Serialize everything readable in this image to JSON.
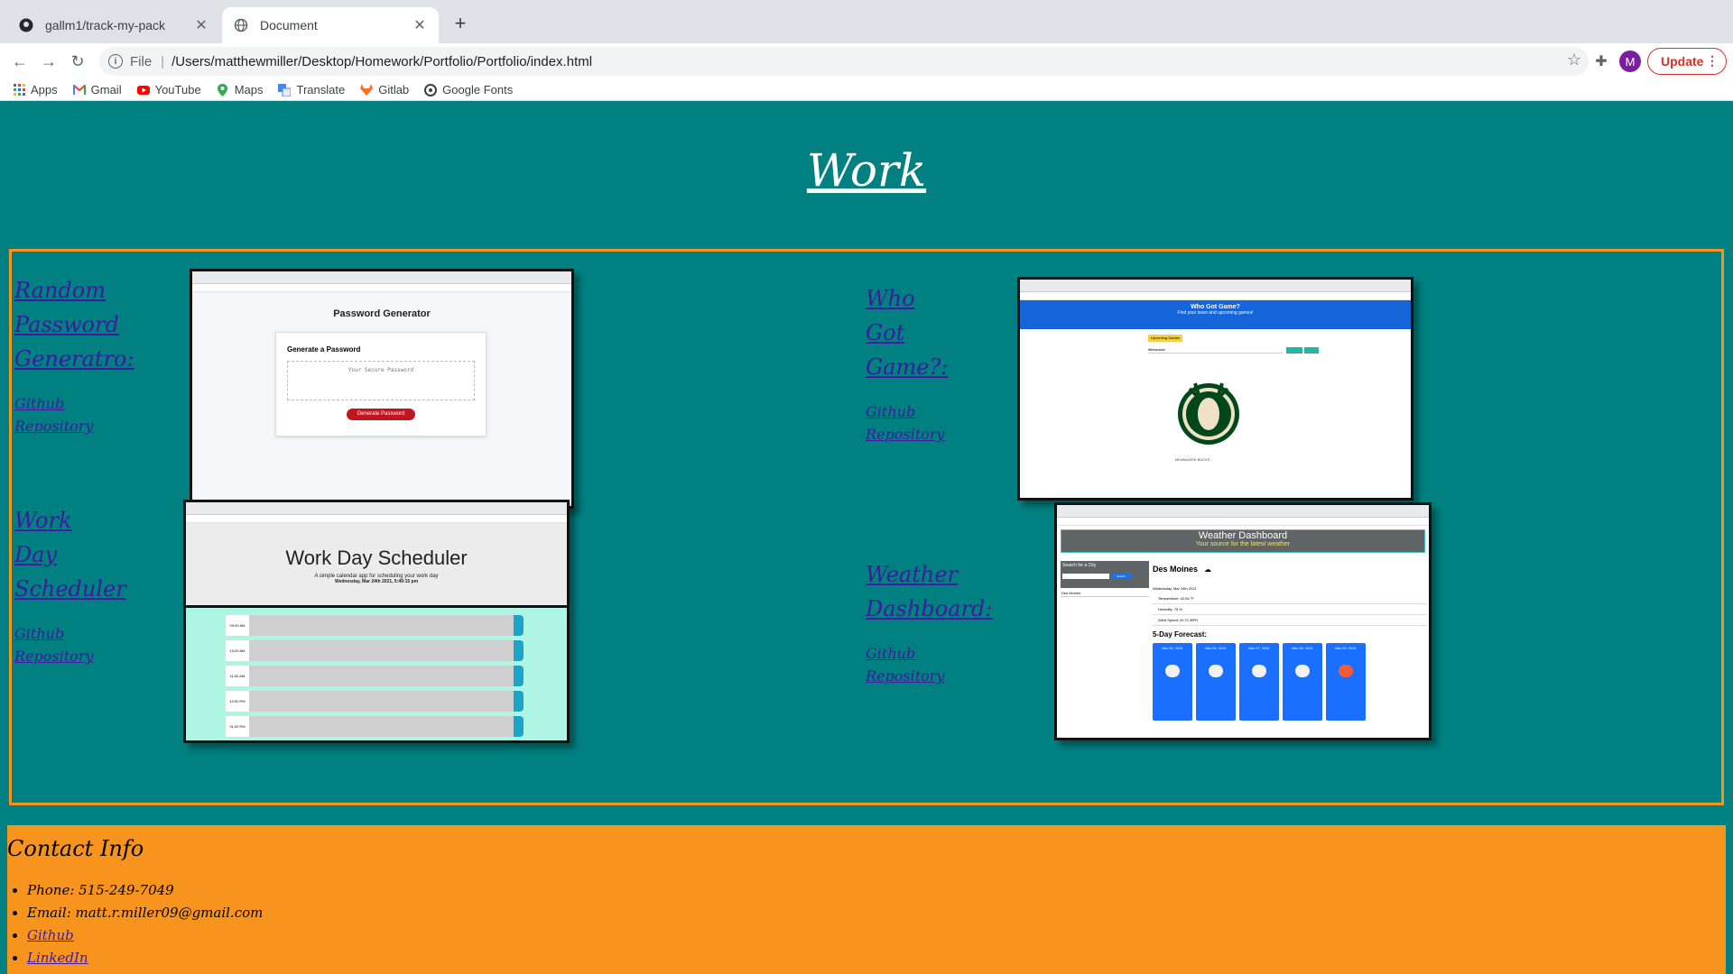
{
  "browser": {
    "tabs": [
      {
        "label": "gallm1/track-my-pack",
        "icon": "github-icon"
      },
      {
        "label": "Document",
        "icon": "globe-icon"
      }
    ],
    "new_tab": "+",
    "address": {
      "scheme": "File",
      "url": "/Users/matthewmiller/Desktop/Homework/Portfolio/Portfolio/index.html"
    },
    "avatar_initial": "M",
    "update_label": "Update",
    "bookmarks": [
      {
        "label": "Apps",
        "icon": "apps-grid-icon"
      },
      {
        "label": "Gmail",
        "icon": "gmail-icon"
      },
      {
        "label": "YouTube",
        "icon": "youtube-icon"
      },
      {
        "label": "Maps",
        "icon": "maps-icon"
      },
      {
        "label": "Translate",
        "icon": "translate-icon"
      },
      {
        "label": "Gitlab",
        "icon": "gitlab-icon"
      },
      {
        "label": "Google Fonts",
        "icon": "google-fonts-icon"
      }
    ]
  },
  "page": {
    "heading": "Work",
    "projects": [
      {
        "title_lines": [
          "Random",
          "Password",
          "Generatro:"
        ],
        "repo_lines": [
          "Github",
          "Repository"
        ],
        "screenshot": {
          "heading": "Password Generator",
          "card_title": "Generate a Password",
          "placeholder": "Your Secure Password",
          "button": "Generate Password"
        }
      },
      {
        "title_lines": [
          "Who",
          "Got",
          "Game?:"
        ],
        "repo_lines": [
          "Github",
          "Repository"
        ],
        "screenshot": {
          "banner_title": "Who Got Game?",
          "banner_sub": "Find your team and upcoming games!",
          "button": "Upcoming Games",
          "input_value": "Milwaukee",
          "logo_text": "MILWAUKEE BUCKS"
        }
      },
      {
        "title_lines": [
          "Work",
          "Day",
          "Scheduler"
        ],
        "repo_lines": [
          "Github",
          "Repository"
        ],
        "screenshot": {
          "heading": "Work Day Scheduler",
          "sub": "A simple calendar app for scheduling your work day",
          "date": "Wednesday, Mar 24th 2021, 5:49:15 pm",
          "hours": [
            "09:00 AM",
            "10:00 AM",
            "11:00 AM",
            "12:00 PM",
            "01:00 PM"
          ]
        }
      },
      {
        "title_lines": [
          "Weather",
          "Dashboard:"
        ],
        "repo_lines": [
          "Github",
          "Repository"
        ],
        "screenshot": {
          "banner_title": "Weather Dashboard",
          "banner_sub": "Your source for the latest weather",
          "search_label": "Search for a City",
          "search_btn": "Search",
          "city_list": "Des Moines",
          "city": "Des Moines",
          "date_line": "Wednesday, Mar 24th 2021",
          "temp": "Temperature: 42.84 °F",
          "humidity": "Humidity: 75 %",
          "wind": "Wind Speed: 20.71 MPH",
          "forecast_title": "5-Day Forecast:",
          "forecast_days": [
            "Mar 25, 2021",
            "Mar 26, 2021",
            "Mar 27, 2021",
            "Mar 28, 2021",
            "Mar 29, 2021"
          ]
        }
      }
    ],
    "contact": {
      "heading": "Contact Info",
      "phone": "Phone: 515-249-7049",
      "email": "Email: matt.r.miller09@gmail.com",
      "github": "Github",
      "linkedin": "LinkedIn"
    }
  },
  "colors": {
    "background": "#008080",
    "accent": "#f7941d",
    "link": "#3f1aa0"
  }
}
